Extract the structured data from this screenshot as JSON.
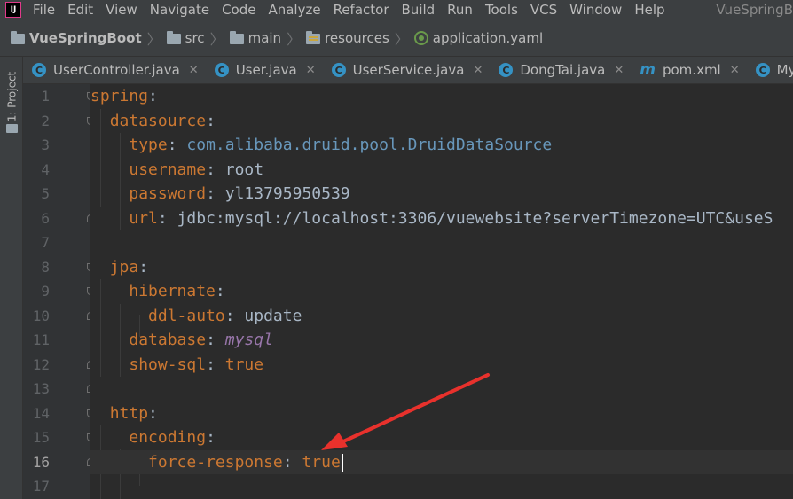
{
  "menu": {
    "items": [
      "File",
      "Edit",
      "View",
      "Navigate",
      "Code",
      "Analyze",
      "Refactor",
      "Build",
      "Run",
      "Tools",
      "VCS",
      "Window",
      "Help"
    ],
    "window_title": "VueSpringB"
  },
  "breadcrumb": {
    "project": "VueSpringBoot",
    "src": "src",
    "main": "main",
    "resources": "resources",
    "file": "application.yaml"
  },
  "side_panel": {
    "project_tab_label": "1: Project"
  },
  "tabs": [
    {
      "label": "UserController.java",
      "icon": "class-c-icon"
    },
    {
      "label": "User.java",
      "icon": "class-c-icon"
    },
    {
      "label": "UserService.java",
      "icon": "class-c-icon"
    },
    {
      "label": "DongTai.java",
      "icon": "class-c-icon"
    },
    {
      "label": "pom.xml",
      "icon": "maven-m-icon"
    },
    {
      "label": "MyFa",
      "icon": "class-c-icon"
    }
  ],
  "editor": {
    "current_line": 16,
    "lines": [
      {
        "n": "1",
        "indent": "",
        "key": "spring",
        "sep": ":",
        "value": "",
        "vclass": ""
      },
      {
        "n": "2",
        "indent": "  ",
        "key": "datasource",
        "sep": ":",
        "value": "",
        "vclass": ""
      },
      {
        "n": "3",
        "indent": "    ",
        "key": "type",
        "sep": ": ",
        "value": "com.alibaba.druid.pool.DruidDataSource",
        "vclass": "pkg"
      },
      {
        "n": "4",
        "indent": "    ",
        "key": "username",
        "sep": ": ",
        "value": "root",
        "vclass": "v"
      },
      {
        "n": "5",
        "indent": "    ",
        "key": "password",
        "sep": ": ",
        "value": "yl13795950539",
        "vclass": "v"
      },
      {
        "n": "6",
        "indent": "    ",
        "key": "url",
        "sep": ": ",
        "value": "jdbc:mysql://localhost:3306/vuewebsite?serverTimezone=UTC&useS",
        "vclass": "v"
      },
      {
        "n": "7",
        "indent": "",
        "key": "",
        "sep": "",
        "value": "",
        "vclass": ""
      },
      {
        "n": "8",
        "indent": "  ",
        "key": "jpa",
        "sep": ":",
        "value": "",
        "vclass": ""
      },
      {
        "n": "9",
        "indent": "    ",
        "key": "hibernate",
        "sep": ":",
        "value": "",
        "vclass": ""
      },
      {
        "n": "10",
        "indent": "      ",
        "key": "ddl-auto",
        "sep": ": ",
        "value": "update",
        "vclass": "v"
      },
      {
        "n": "11",
        "indent": "    ",
        "key": "database",
        "sep": ": ",
        "value": "mysql",
        "vclass": "it"
      },
      {
        "n": "12",
        "indent": "    ",
        "key": "show-sql",
        "sep": ": ",
        "value": "true",
        "vclass": "k"
      },
      {
        "n": "13",
        "indent": "",
        "key": "",
        "sep": "",
        "value": "",
        "vclass": ""
      },
      {
        "n": "14",
        "indent": "  ",
        "key": "http",
        "sep": ":",
        "value": "",
        "vclass": ""
      },
      {
        "n": "15",
        "indent": "    ",
        "key": "encoding",
        "sep": ":",
        "value": "",
        "vclass": ""
      },
      {
        "n": "16",
        "indent": "      ",
        "key": "force-response",
        "sep": ": ",
        "value": "true",
        "vclass": "k"
      },
      {
        "n": "17",
        "indent": "",
        "key": "",
        "sep": "",
        "value": "",
        "vclass": ""
      }
    ]
  },
  "colors": {
    "background": "#2b2b2b",
    "gutter": "#313335",
    "toolbar": "#3c3f41",
    "keyword": "#cc7832",
    "number_type": "#6897bb",
    "annotation_arrow": "#e8312c"
  }
}
